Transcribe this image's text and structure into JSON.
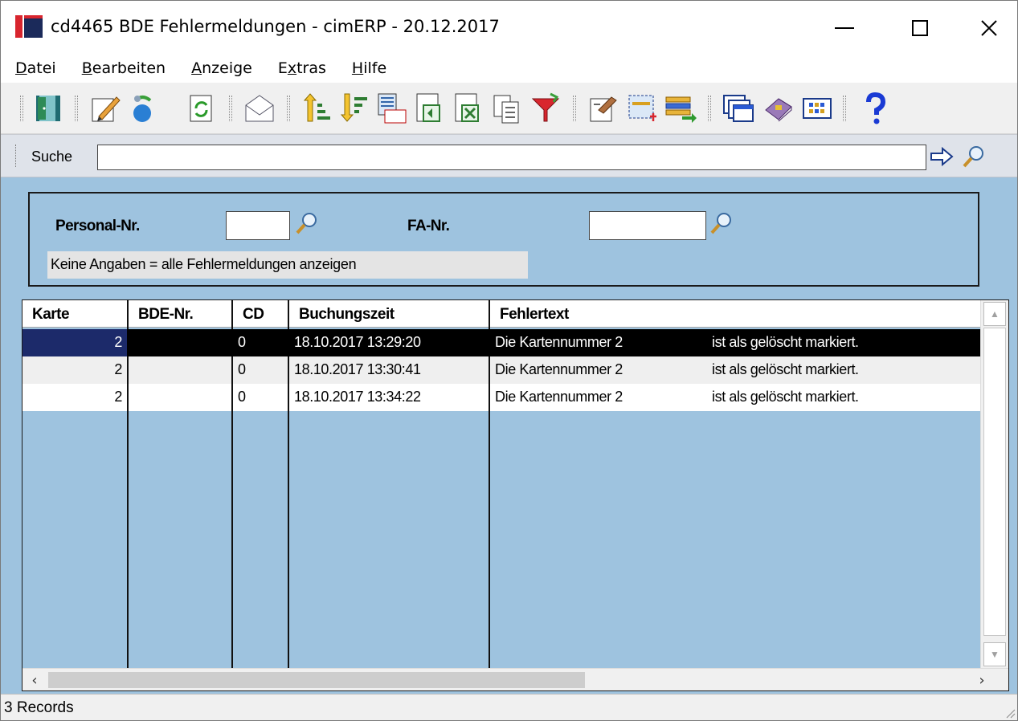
{
  "window": {
    "title": "cd4465 BDE Fehlermeldungen - cimERP - 20.12.2017"
  },
  "menu": {
    "items": [
      {
        "label": "Datei",
        "first": "D",
        "rest": "atei"
      },
      {
        "label": "Bearbeiten",
        "first": "B",
        "rest": "earbeiten"
      },
      {
        "label": "Anzeige",
        "first": "A",
        "rest": "nzeige"
      },
      {
        "label": "Extras",
        "first": "E",
        "mid": "x",
        "rest": "tras"
      },
      {
        "label": "Hilfe",
        "first": "H",
        "rest": "ilfe"
      }
    ]
  },
  "toolbar": {
    "buttons": [
      "exit-door",
      "edit-pencil",
      "recycle",
      "refresh",
      "mail",
      "sort-ascending",
      "sort-descending",
      "number-list",
      "export-page",
      "export-excel",
      "copy",
      "filter",
      "properties",
      "select-area",
      "insert-record",
      "windows",
      "book",
      "grid-view",
      "help"
    ]
  },
  "search": {
    "label": "Suche",
    "value": ""
  },
  "filter": {
    "personal_label": "Personal-Nr.",
    "personal_value": "",
    "fa_label": "FA-Nr.",
    "fa_value": "",
    "hint": "Keine Angaben = alle Fehlermeldungen anzeigen"
  },
  "table": {
    "columns": [
      "Karte",
      "BDE-Nr.",
      "CD",
      "Buchungszeit",
      "Fehlertext"
    ],
    "rows": [
      {
        "karte": "2",
        "bde": "",
        "cd": "0",
        "zeit": "18.10.2017 13:29:20",
        "text1": "Die Kartennummer 2",
        "text2": "ist als gelöscht markiert."
      },
      {
        "karte": "2",
        "bde": "",
        "cd": "0",
        "zeit": "18.10.2017 13:30:41",
        "text1": "Die Kartennummer 2",
        "text2": "ist als gelöscht markiert."
      },
      {
        "karte": "2",
        "bde": "",
        "cd": "0",
        "zeit": "18.10.2017 13:34:22",
        "text1": "Die Kartennummer 2",
        "text2": "ist als gelöscht markiert."
      }
    ]
  },
  "status": {
    "text": "3 Records"
  },
  "colors": {
    "background": "#9ec3df",
    "selected_row": "#000000",
    "selected_cell": "#1c2a6a",
    "brand_red": "#d8252e"
  }
}
